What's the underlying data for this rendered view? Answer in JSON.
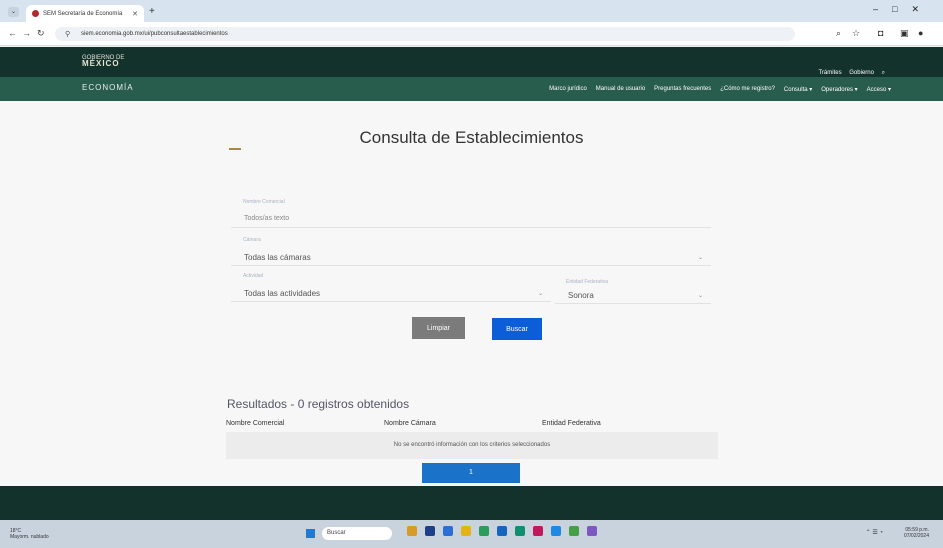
{
  "browser": {
    "tab_title": "SEM Secretaría de Economía",
    "url": "siem.economia.gob.mx/ui/pubconsultaestablecimientos"
  },
  "header": {
    "logo_top": "GOBIERNO DE",
    "logo_main": "MÉXICO",
    "section": "ECONOMÍA",
    "links": [
      "Trámites",
      "Gobierno"
    ],
    "menu": [
      "Marco jurídico",
      "Manual de usuario",
      "Preguntas frecuentes",
      "¿Cómo me registro?",
      "Consulta ▾",
      "Operadores ▾",
      "Acceso ▾"
    ]
  },
  "page": {
    "title": "Consulta de Establecimientos"
  },
  "form": {
    "nombre_placeholder": "Nombre Comercial",
    "nombre_value": "Todos/as texto",
    "camara_label": "Cámara",
    "camara_value": "Todas las cámaras",
    "actividad_label": "Actividad",
    "actividad_value": "Todas las actividades",
    "entidad_label": "Entidad Federativa",
    "entidad_value": "Sonora",
    "limpiar": "Limpiar",
    "buscar": "Buscar"
  },
  "results": {
    "title": "Resultados - 0 registros obtenidos",
    "columns": [
      "Nombre Comercial",
      "Nombre Cámara",
      "Entidad Federativa"
    ],
    "empty_message": "No se encontró información con los criterios seleccionados",
    "page": "1"
  },
  "taskbar": {
    "search": "Buscar",
    "weather_temp": "18°C",
    "weather_text": "Mayorm. nublado",
    "time": "05:59 p.m.",
    "date": "07/02/2024"
  }
}
